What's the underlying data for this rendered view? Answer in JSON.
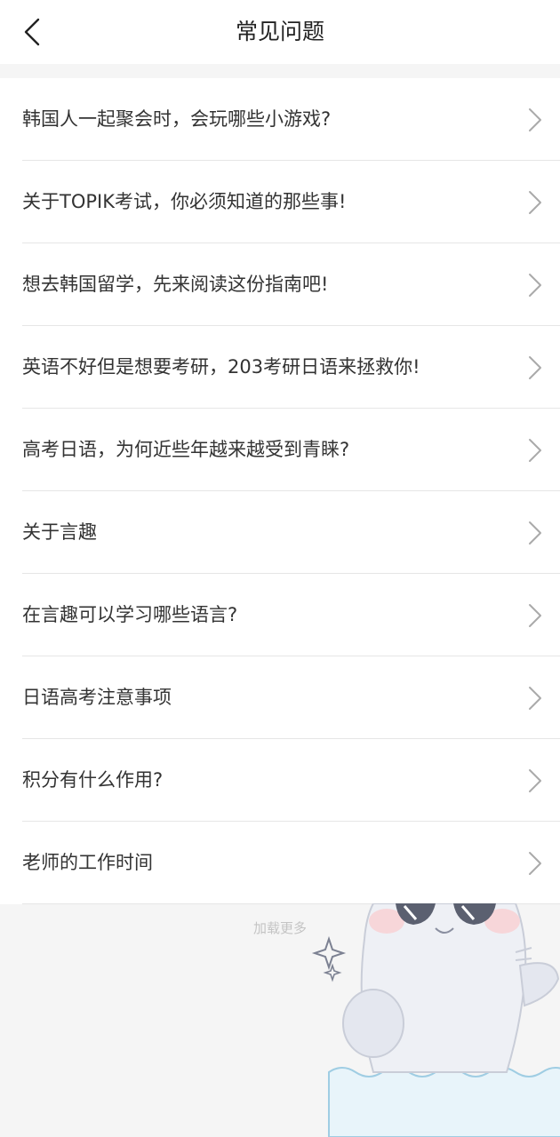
{
  "header": {
    "title": "常见问题"
  },
  "faq": {
    "items": [
      {
        "label": "韩国人一起聚会时，会玩哪些小游戏?"
      },
      {
        "label": "关于TOPIK考试，你必须知道的那些事!"
      },
      {
        "label": "想去韩国留学，先来阅读这份指南吧!"
      },
      {
        "label": "英语不好但是想要考研，203考研日语来拯救你!"
      },
      {
        "label": "高考日语，为何近些年越来越受到青睐?"
      },
      {
        "label": "关于言趣"
      },
      {
        "label": "在言趣可以学习哪些语言?"
      },
      {
        "label": "日语高考注意事项"
      },
      {
        "label": "积分有什么作用?"
      },
      {
        "label": "老师的工作时间"
      }
    ]
  },
  "footer": {
    "load_more": "加载更多"
  },
  "icons": {
    "back": "chevron-left-icon",
    "row_arrow": "chevron-right-icon",
    "decoration": "seal-mascot-with-sunglasses"
  },
  "colors": {
    "background": "#f5f5f5",
    "card": "#ffffff",
    "text": "#333333",
    "chevron": "#aaaaaa",
    "divider": "#e6e6e6",
    "load_more": "#c4c4c4",
    "water": "#e8f4fa"
  }
}
